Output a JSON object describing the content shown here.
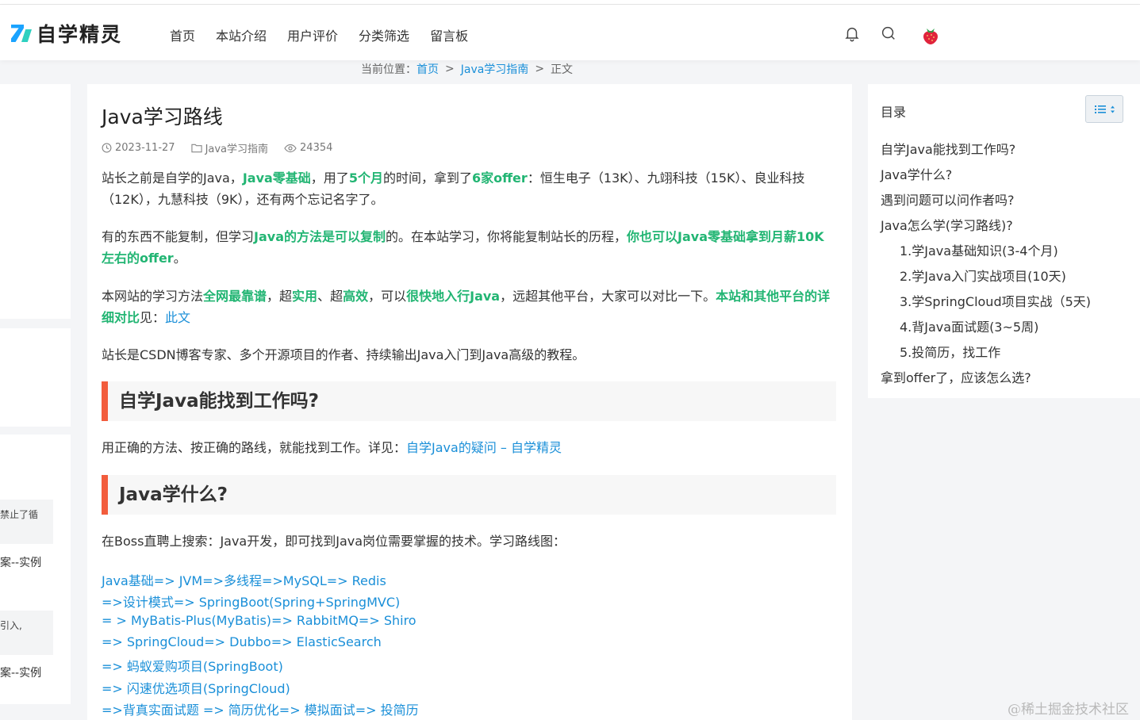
{
  "site": {
    "logo_text_z": "Z",
    "logo_text": "自学精灵",
    "nav": [
      "首页",
      "本站介绍",
      "用户评价",
      "分类筛选",
      "留言板"
    ]
  },
  "breadcrumb": {
    "label": "当前位置：",
    "home": "首页",
    "category": "Java学习指南",
    "current": "正文"
  },
  "sidebar_left": {
    "snippets": [
      "禁止了循",
      "案--实例",
      "引入,",
      "案--实例"
    ]
  },
  "article": {
    "title": "Java学习路线",
    "date": "2023-11-27",
    "category": "Java学习指南",
    "views": "24354",
    "p1": {
      "t1": "站长之前是自学的Java，",
      "g1": "Java零基础",
      "t2": "，用了",
      "g2": "5个月",
      "t3": "的时间，拿到了",
      "g3": "6家offer",
      "t4": "：恒生电子（13K）、九翊科技（15K）、良业科技（12K），九慧科技（9K），还有两个忘记名字了。"
    },
    "p2": {
      "t1": "有的东西不能复制，但学习",
      "g1": "Java的方法是可以复制",
      "t2": "的。在本站学习，你将能复制站长的历程，",
      "g2": "你也可以Java零基础拿到月薪10K左右的offer",
      "t3": "。"
    },
    "p3": {
      "t1": "本网站的学习方法",
      "g1": "全网最靠谱",
      "t2": "，超",
      "g2": "实用",
      "t3": "、超",
      "g3": "高效",
      "t4": "，可以",
      "g4": "很快地入行Java",
      "t5": "，远超其他平台，大家可以对比一下。",
      "g5": "本站和其他平台的详细对比",
      "t6": "见：",
      "link": "此文"
    },
    "p4": "站长是CSDN博客专家、多个开源项目的作者、持续输出Java入门到Java高级的教程。",
    "h1": "自学Java能找到工作吗?",
    "p5": {
      "t1": "用正确的方法、按正确的路线，就能找到工作。详见：",
      "link": "自学Java的疑问 – 自学精灵"
    },
    "h2": "Java学什么?",
    "p6": "在Boss直聘上搜索：Java开发，即可找到Java岗位需要掌握的技术。学习路线图：",
    "route": [
      "Java基础=> JVM=>多线程=>MySQL=> Redis",
      "=>设计模式=> SpringBoot(Spring+SpringMVC)",
      "= > MyBatis-Plus(MyBatis)=> RabbitMQ=> Shiro",
      "=> SpringCloud=> Dubbo=> ElasticSearch",
      "=> 蚂蚁爱购项目(SpringBoot)",
      "=> 闪速优选项目(SpringCloud)",
      "=>背真实面试题 => 简历优化=> 模拟面试=> 投简历"
    ]
  },
  "toc": {
    "title": "目录",
    "items": [
      "自学Java能找到工作吗?",
      "Java学什么?",
      "遇到问题可以问作者吗?",
      "Java怎么学(学习路线)?",
      "1.学Java基础知识(3-4个月)",
      "2.学Java入门实战项目(10天)",
      "3.学SpringCloud项目实战（5天)",
      "4.背Java面试题(3~5周)",
      "5.投简历，找工作",
      "拿到offer了，应该怎么选?"
    ]
  },
  "watermark": "@稀土掘金技术社区"
}
